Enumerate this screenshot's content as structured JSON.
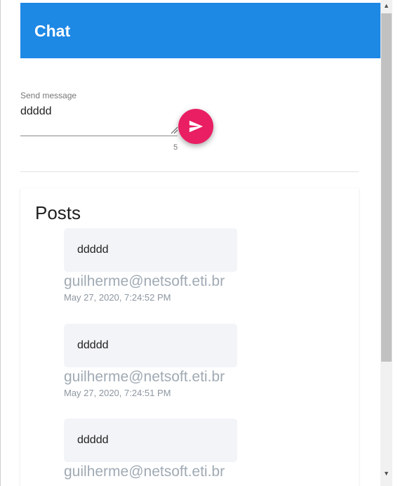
{
  "header": {
    "title": "Chat",
    "background_color": "#1e88e5"
  },
  "send_form": {
    "label": "Send message",
    "value": "ddddd",
    "char_count": "5",
    "send_icon": "send-icon",
    "button_color": "#e91e63"
  },
  "posts": {
    "heading": "Posts",
    "items": [
      {
        "message": "ddddd",
        "author": "guilherme@netsoft.eti.br",
        "timestamp": "May 27, 2020, 7:24:52 PM"
      },
      {
        "message": "ddddd",
        "author": "guilherme@netsoft.eti.br",
        "timestamp": "May 27, 2020, 7:24:51 PM"
      },
      {
        "message": "ddddd",
        "author": "guilherme@netsoft.eti.br",
        "timestamp": ""
      }
    ]
  },
  "scrollbar": {
    "up_icon": "arrow-up-icon",
    "down_icon": "arrow-down-icon"
  }
}
